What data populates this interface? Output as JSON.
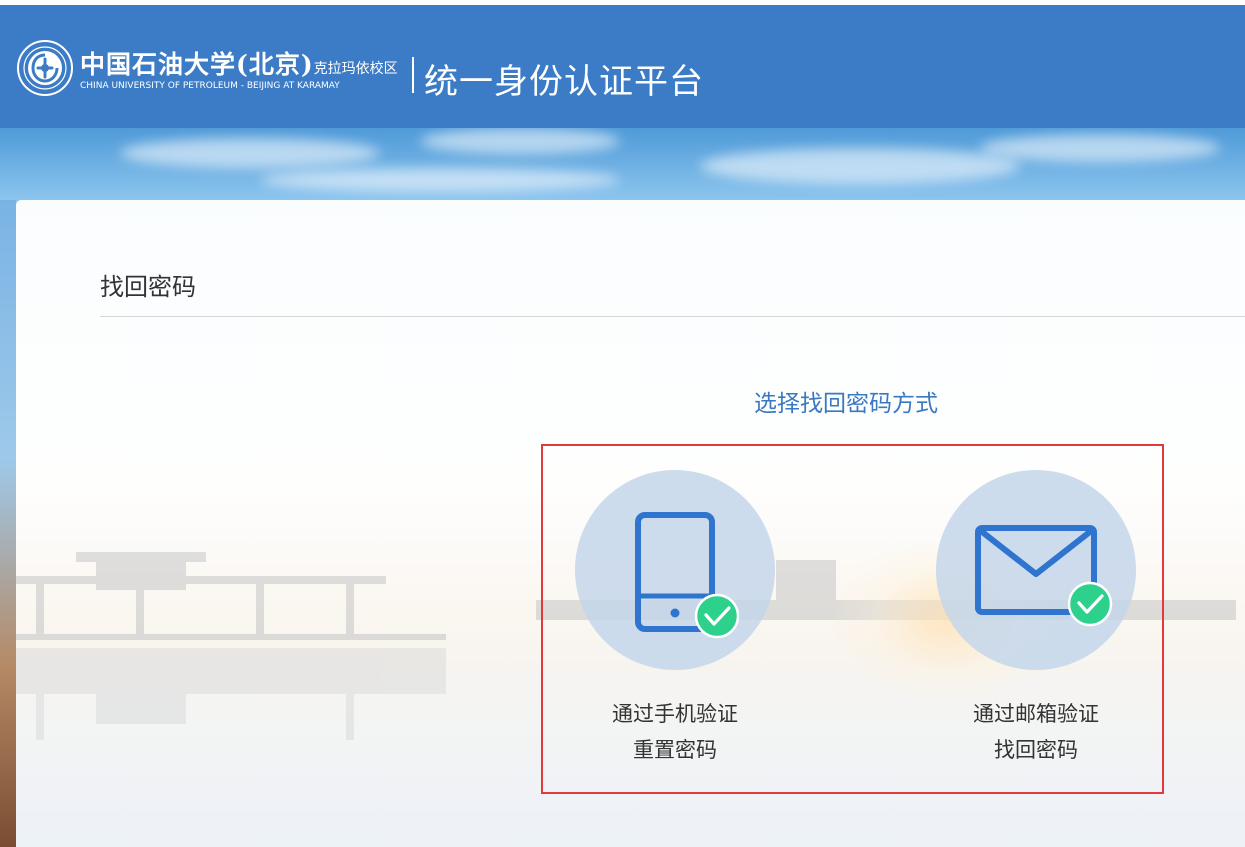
{
  "header": {
    "logo_cn_name": "中国石油大学(北京)",
    "logo_cn_suffix": "克拉玛依校区",
    "logo_en_name": "CHINA UNIVERSITY OF PETROLEUM - BEIJING  AT KARAMAY",
    "platform_title": "统一身份认证平台",
    "bg_color": "#3c7cc6"
  },
  "page": {
    "title": "找回密码",
    "choose_label": "选择找回密码方式",
    "accent_color": "#3a78c2",
    "highlight_border_color": "#e2393b"
  },
  "options": [
    {
      "icon": "mobile-phone-check-icon",
      "line1": "通过手机验证",
      "line2": "重置密码"
    },
    {
      "icon": "envelope-check-icon",
      "line1": "通过邮箱验证",
      "line2": "找回密码"
    }
  ]
}
